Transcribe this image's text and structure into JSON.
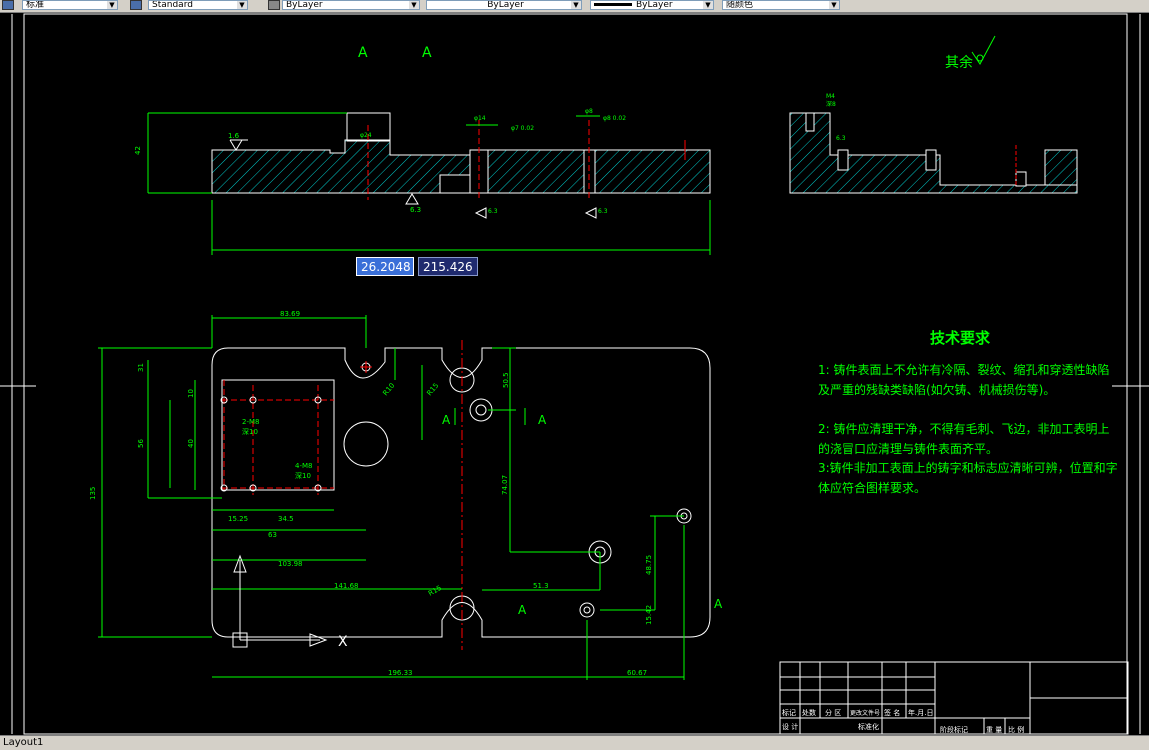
{
  "toolbar": {
    "style_dropdown": "标准",
    "dimstyle_dropdown": "Standard",
    "layer_color": "ByLayer",
    "linetype": "ByLayer",
    "lineweight": "ByLayer",
    "plotstyle": "随颜色"
  },
  "dynamic_input": {
    "value1": "26.2048",
    "value2": "215.426"
  },
  "drawing": {
    "section_labels": [
      "A",
      "A"
    ],
    "roughness_other": "其余",
    "roughness_values": [
      "1.6",
      "6.3",
      "6.3",
      "6.3",
      "6.3"
    ],
    "dims_plan": {
      "d1": "83.69",
      "d2": "135",
      "d3": "31",
      "d4": "56",
      "d5": "40",
      "d6": "10",
      "d7": "15.25",
      "d8": "34.5",
      "d9": "63",
      "d10": "103.98",
      "d11": "141.68",
      "d12": "196.33",
      "d13": "60.67",
      "d14": "51.3",
      "d15": "74.07",
      "d16": "50.5",
      "d17": "48.75",
      "d18": "15.42",
      "d19": "2-M8",
      "d20": "深10",
      "d21": "4-M8",
      "d22": "深10",
      "d23": "R10",
      "d24": "R15",
      "d25": "R15"
    },
    "label_A_marks": [
      "A",
      "A",
      "A",
      "A"
    ]
  },
  "tech_requirements": {
    "title": "技术要求",
    "item1": "1: 铸件表面上不允许有冷隔、裂纹、缩孔和穿透性缺陷及严重的残缺类缺陷(如欠铸、机械损伤等)。",
    "item2": "2: 铸件应清理干净，不得有毛刺、飞边，非加工表明上的浇冒口应清理与铸件表面齐平。",
    "item3": "3:铸件非加工表面上的铸字和标志应清晰可辨，位置和字体应符合图样要求。"
  },
  "title_block": {
    "row1": [
      "标记",
      "处数",
      "分 区",
      "更改文件号",
      "签 名",
      "年.月.日"
    ],
    "row2": [
      "设 计",
      "",
      "",
      "标准化",
      "",
      ""
    ],
    "right": [
      "阶段标记",
      "重 量",
      "比 例"
    ]
  },
  "statusbar": {
    "layout_tab": "Layout1"
  },
  "colors": {
    "green": "#00ff00",
    "cyan": "#00ffff",
    "white": "#ffffff",
    "red": "#ff0000"
  }
}
